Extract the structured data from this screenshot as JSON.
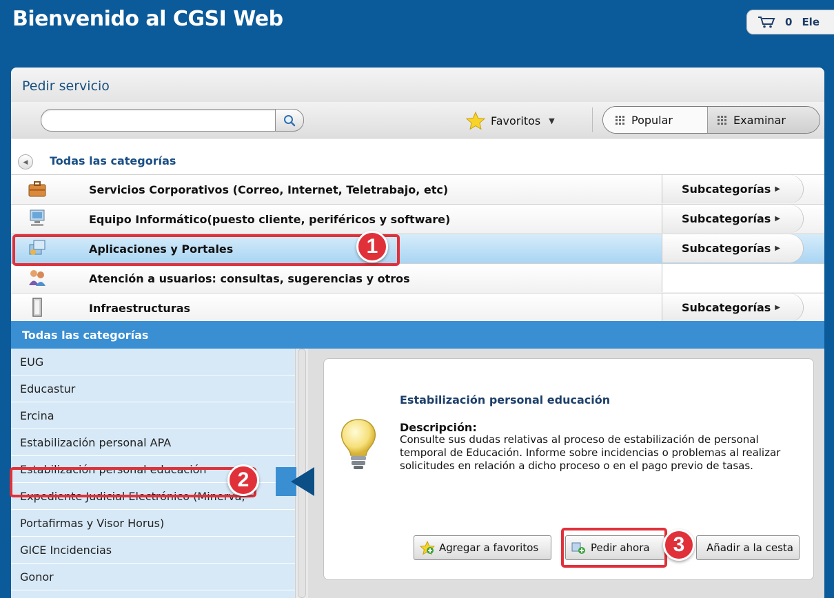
{
  "header": {
    "title": "Bienvenido al CGSI Web",
    "cart_count": "0",
    "user_label": "Ele"
  },
  "panel": {
    "title": "Pedir servicio"
  },
  "toolbar": {
    "search_placeholder": "",
    "favorites_label": "Favoritos",
    "popular_label": "Popular",
    "browse_label": "Examinar"
  },
  "breadcrumb": {
    "label": "Todas las categorías"
  },
  "categories": [
    {
      "label": "Servicios Corporativos (Correo, Internet, Teletrabajo, etc)",
      "subcategories": "Subcategorías",
      "icon": "briefcase-icon"
    },
    {
      "label": "Equipo Informático(puesto cliente, periféricos y software)",
      "subcategories": "Subcategorías",
      "icon": "computer-icon"
    },
    {
      "label": "Aplicaciones y Portales",
      "subcategories": "Subcategorías",
      "icon": "applications-icon",
      "selected": true
    },
    {
      "label": "Atención a usuarios: consultas, sugerencias y otros",
      "subcategories": "",
      "icon": "users-icon"
    },
    {
      "label": "Infraestructuras",
      "subcategories": "Subcategorías",
      "icon": "server-icon"
    }
  ],
  "all_categories_label": "Todas las categorías",
  "sidebar": {
    "items": [
      "EUG",
      "Educastur",
      "Ercina",
      "Estabilización personal APA",
      "Estabilización personal educación",
      "Expediente Judicial Electrónico (Minerva,",
      "Portafirmas y Visor Horus)",
      "GICE Incidencias",
      "Gonor"
    ],
    "active_index": 4
  },
  "detail": {
    "title": "Estabilización personal educación",
    "description_label": "Descripción:",
    "description": "Consulte sus dudas relativas al proceso de estabilización de personal temporal de Educación. Informe sobre incidencias o problemas al realizar solicitudes en relación a dicho proceso o en el pago previo de tasas.",
    "add_favorites_label": "Agregar a favoritos",
    "order_now_label": "Pedir ahora",
    "add_to_cart_label": "Añadir a la cesta"
  },
  "callouts": [
    "1",
    "2",
    "3"
  ],
  "colors": {
    "brand_blue": "#0b5a99",
    "section_bar": "#3a8fd3",
    "selected_row": "#a9d5f3",
    "sidebar_bg": "#d7e9f7",
    "callout_red": "#e0313a"
  }
}
